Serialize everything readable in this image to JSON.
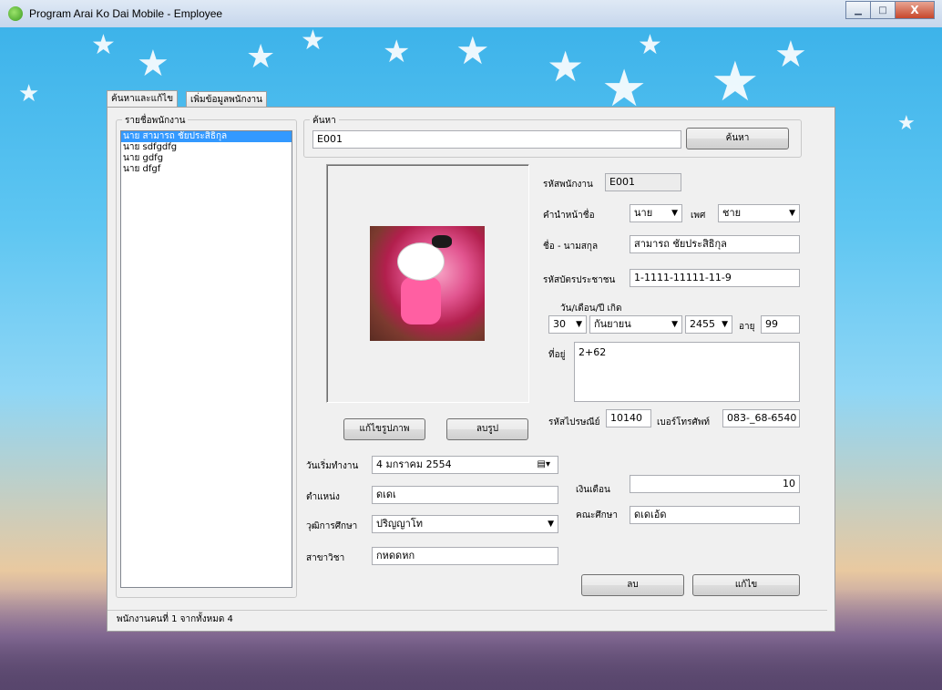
{
  "window": {
    "title": "Program Arai Ko Dai Mobile - Employee",
    "minimize": "▁",
    "maximize": "□",
    "close": "X"
  },
  "tabs": [
    {
      "label": "ค้นหาและแก้ไข",
      "active": true
    },
    {
      "label": "เพิ่มข้อมูลพนักงาน",
      "active": false
    }
  ],
  "employee_list": {
    "legend": "รายชื่อพนักงาน",
    "items": [
      "นาย สามารถ ชัยประสิธิกุล",
      "นาย sdfgdfg",
      "นาย gdfg",
      "นาย dfgf"
    ],
    "selected_index": 0
  },
  "search": {
    "legend": "ค้นหา",
    "value": "E001",
    "button": "ค้นหา"
  },
  "photo": {
    "edit_button": "แก้ไขรูปภาพ",
    "delete_button": "ลบรูป"
  },
  "form": {
    "employee_id_label": "รหัสพนักงาน",
    "employee_id": "E001",
    "prefix_label": "คำนำหน้าชื่อ",
    "prefix": "นาย",
    "gender_label": "เพศ",
    "gender": "ชาย",
    "name_label": "ชื่อ - นามสกุล",
    "name": "สามารถ ชัยประสิธิกุล",
    "citizen_id_label": "รหัสบัตรประชาชน",
    "citizen_id": "1-1111-11111-11-9",
    "dob_label": "วัน/เดือน/ปี เกิด",
    "dob_day": "30",
    "dob_month": "กันยายน",
    "dob_year": "2455",
    "age_label": "อายุ",
    "age": "99",
    "address_label": "ที่อยู่",
    "address": "2+62",
    "postal_label": "รหัสไปรษณีย์",
    "postal": "10140",
    "phone_label": "เบอร์โทรศัพท์",
    "phone": "083-_68-6540",
    "start_date_label": "วันเริ่มทำงาน",
    "start_date": "4   มกราคม    2554",
    "position_label": "ตำแหน่ง",
    "position": "ดเดเ",
    "salary_label": "เงินเดือน",
    "salary": "10",
    "education_label": "วุฒิการศึกษา",
    "education": "ปริญญาโท",
    "faculty_label": "คณะศึกษา",
    "faculty": "ดเดเอ้ด",
    "major_label": "สาขาวิชา",
    "major": "กหดดหก"
  },
  "actions": {
    "delete": "ลบ",
    "edit": "แก้ไข"
  },
  "status": {
    "text": "พนักงานคนที่  1 จากทั้งหมด 4"
  },
  "colors": {
    "selection": "#3399ff",
    "sky": "#3db3ea"
  }
}
